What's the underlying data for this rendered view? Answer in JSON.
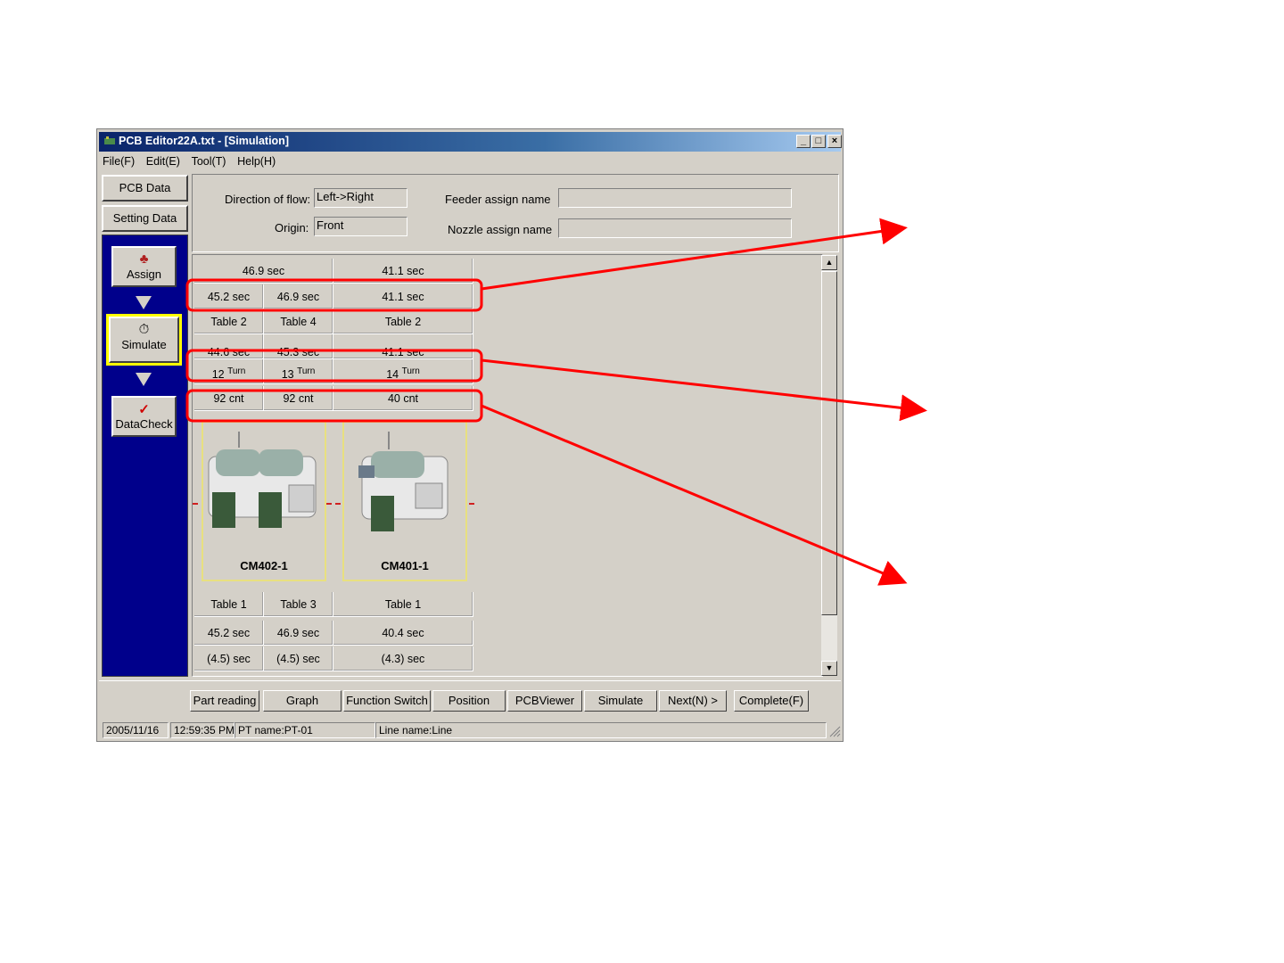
{
  "window": {
    "title": "PCB Editor22A.txt - [Simulation]",
    "controls": {
      "minimize": "_",
      "maximize": "□",
      "close": "×"
    }
  },
  "menu": [
    "File(F)",
    "Edit(E)",
    "Tool(T)",
    "Help(H)"
  ],
  "nav": {
    "pcb_data": "PCB Data",
    "setting_data": "Setting Data"
  },
  "sidebar": {
    "assign": {
      "label": "Assign",
      "icon": "assign-icon"
    },
    "simulate": {
      "label": "Simulate",
      "icon": "stopwatch-icon"
    },
    "datacheck": {
      "label": "DataCheck",
      "icon": "checkmark-icon"
    }
  },
  "info": {
    "direction_label": "Direction of flow:",
    "direction_value": "Left->Right",
    "origin_label": "Origin:",
    "origin_value": "Front",
    "feeder_label": "Feeder assign name",
    "feeder_value": "",
    "nozzle_label": "Nozzle assign name",
    "nozzle_value": ""
  },
  "grid": {
    "row_total": [
      "46.9 sec",
      "41.1 sec"
    ],
    "row_times": [
      "45.2 sec",
      "46.9 sec",
      "41.1 sec"
    ],
    "row_tables_top": [
      "Table 2",
      "Table 4",
      "Table 2"
    ],
    "row_partial": [
      "44.6 sec",
      "45.3 sec",
      "41.1 sec"
    ],
    "row_turns": [
      {
        "num": "12",
        "unit": "Turn"
      },
      {
        "num": "13",
        "unit": "Turn"
      },
      {
        "num": "14",
        "unit": "Turn"
      }
    ],
    "row_counts": [
      "92 cnt",
      "92 cnt",
      "40 cnt"
    ],
    "machines": [
      "CM402-1",
      "CM401-1"
    ],
    "row_tables_bottom": [
      "Table 1",
      "Table 3",
      "Table 1"
    ],
    "row_bottom_times": [
      "45.2 sec",
      "46.9 sec",
      "40.4 sec"
    ],
    "row_bottom_paren": [
      "(4.5) sec",
      "(4.5) sec",
      "(4.3) sec"
    ]
  },
  "toolbar": [
    "Part reading",
    "Graph",
    "Function Switch",
    "Position",
    "PCBViewer",
    "Simulate",
    "Next(N) >",
    "Complete(F)"
  ],
  "status": {
    "date": "2005/11/16",
    "time": "12:59:35 PM",
    "pt_name": "PT name:PT-01",
    "line_name": "Line name:Line"
  },
  "colors": {
    "highlight": "#ff0000",
    "sidebar_bg": "#00008b",
    "active_border": "#ffff00"
  }
}
